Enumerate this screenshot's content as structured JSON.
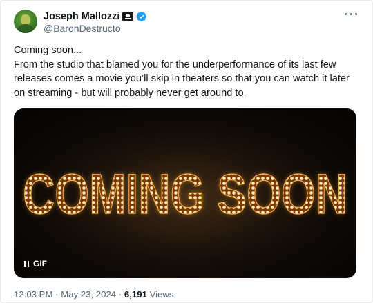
{
  "author": {
    "display_name": "Joseph Mallozzi",
    "flag_icon": "pirate-flag-icon",
    "verified_icon": "verified-badge-icon",
    "verified_color": "#1d9bf0",
    "handle": "@BaronDestructo"
  },
  "tweet": {
    "text": "Coming soon...\nFrom the studio that blamed you for the underperformance of its last few releases comes a movie you’ll skip in theaters so that you can watch it later on streaming - but will probably never get around to."
  },
  "media": {
    "banner_text": "COMING SOON",
    "badge_label": "GIF",
    "badge_icon": "pause-icon",
    "glow_color": "#f0a030"
  },
  "meta": {
    "time": "12:03 PM",
    "date": "May 23, 2024",
    "separator": "·",
    "views_count": "6,191",
    "views_label": "Views"
  },
  "menu": {
    "more_icon": "more-options-icon"
  }
}
